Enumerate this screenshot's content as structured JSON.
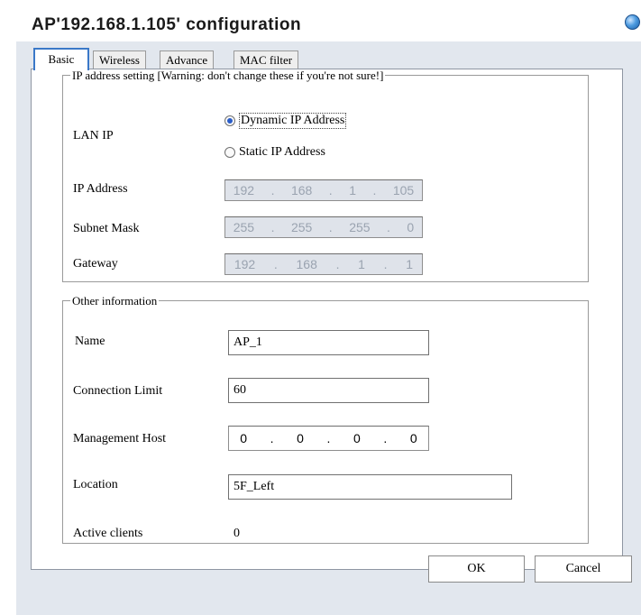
{
  "window": {
    "title": "AP'192.168.1.105' configuration"
  },
  "tabs": [
    "Basic",
    "Wireless",
    "Advance",
    "MAC filter"
  ],
  "ip_group": {
    "legend": "IP address setting [Warning: don't change these if you're not sure!]",
    "lan_ip_label": "LAN IP",
    "radio_dynamic": "Dynamic IP Address",
    "radio_static": "Static IP Address",
    "selected": "Dynamic IP Address",
    "ip_label": "IP Address",
    "ip": [
      "192",
      "168",
      "1",
      "105"
    ],
    "mask_label": "Subnet Mask",
    "mask": [
      "255",
      "255",
      "255",
      "0"
    ],
    "gateway_label": "Gateway",
    "gateway": [
      "192",
      "168",
      "1",
      "1"
    ]
  },
  "other_group": {
    "legend": "Other information",
    "name_label": "Name",
    "name_value": "AP_1",
    "conn_label": "Connection Limit",
    "conn_value": "60",
    "mgmt_label": "Management Host",
    "mgmt": [
      "0",
      "0",
      "0",
      "0"
    ],
    "location_label": "Location",
    "location_value": "5F_Left",
    "active_label": "Active clients",
    "active_value": "0"
  },
  "buttons": {
    "ok": "OK",
    "cancel": "Cancel"
  },
  "colors": {
    "dialog_bg": "#e2e7ee",
    "tab_border": "#3a78c8",
    "disabled_field": "#dfe3ea"
  },
  "icons": {
    "window_orb": "window-orb-icon"
  }
}
